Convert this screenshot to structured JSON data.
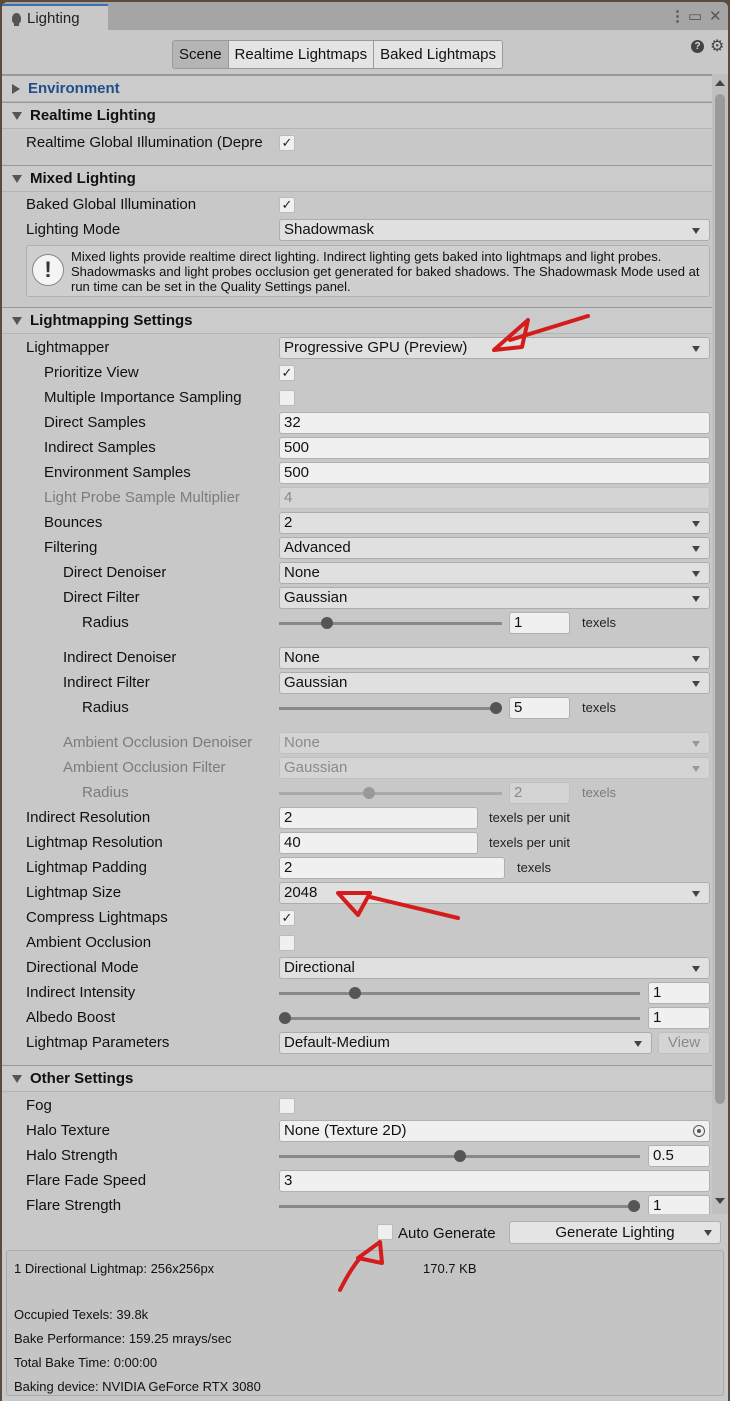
{
  "window": {
    "tab_title": "Lighting",
    "tab_icon": "bulb-icon",
    "controls": [
      "more-icon",
      "maximize-icon",
      "close-icon"
    ]
  },
  "toolbar": {
    "tabs": [
      {
        "label": "Scene",
        "active": true
      },
      {
        "label": "Realtime Lightmaps",
        "active": false
      },
      {
        "label": "Baked Lightmaps",
        "active": false
      }
    ],
    "help_icon": "?",
    "settings_icon": "gear-icon"
  },
  "sections": {
    "environment": {
      "title": "Environment",
      "expanded": false
    },
    "realtime": {
      "title": "Realtime Lighting",
      "expanded": true,
      "realtime_gi_label": "Realtime Global Illumination (Depre",
      "realtime_gi_checked": true
    },
    "mixed": {
      "title": "Mixed Lighting",
      "expanded": true,
      "baked_gi_label": "Baked Global Illumination",
      "baked_gi_checked": true,
      "lighting_mode_label": "Lighting Mode",
      "lighting_mode_value": "Shadowmask",
      "help_text": "Mixed lights provide realtime direct lighting. Indirect lighting gets baked into lightmaps and light probes. Shadowmasks and light probes occlusion get generated for baked shadows. The Shadowmask Mode used at run time can be set in the Quality Settings panel."
    },
    "lightmapping": {
      "title": "Lightmapping Settings",
      "expanded": true,
      "lightmapper": {
        "label": "Lightmapper",
        "value": "Progressive GPU (Preview)"
      },
      "prioritize_view": {
        "label": "Prioritize View",
        "checked": true
      },
      "mis": {
        "label": "Multiple Importance Sampling",
        "checked": false
      },
      "direct_samples": {
        "label": "Direct Samples",
        "value": "32"
      },
      "indirect_samples": {
        "label": "Indirect Samples",
        "value": "500"
      },
      "environment_samples": {
        "label": "Environment Samples",
        "value": "500"
      },
      "light_probe_mult": {
        "label": "Light Probe Sample Multiplier",
        "value": "4",
        "disabled": true
      },
      "bounces": {
        "label": "Bounces",
        "value": "2"
      },
      "filtering": {
        "label": "Filtering",
        "value": "Advanced"
      },
      "direct_denoiser": {
        "label": "Direct Denoiser",
        "value": "None"
      },
      "direct_filter": {
        "label": "Direct Filter",
        "value": "Gaussian"
      },
      "direct_radius": {
        "label": "Radius",
        "value": "1",
        "unit": "texels",
        "slider_fraction": 0.2
      },
      "indirect_denoiser": {
        "label": "Indirect Denoiser",
        "value": "None"
      },
      "indirect_filter": {
        "label": "Indirect Filter",
        "value": "Gaussian"
      },
      "indirect_radius": {
        "label": "Radius",
        "value": "5",
        "unit": "texels",
        "slider_fraction": 1.0
      },
      "ao_denoiser": {
        "label": "Ambient Occlusion Denoiser",
        "value": "None",
        "disabled": true
      },
      "ao_filter": {
        "label": "Ambient Occlusion Filter",
        "value": "Gaussian",
        "disabled": true
      },
      "ao_radius": {
        "label": "Radius",
        "value": "2",
        "unit": "texels",
        "slider_fraction": 0.4,
        "disabled": true
      },
      "indirect_resolution": {
        "label": "Indirect Resolution",
        "value": "2",
        "unit": "texels per unit"
      },
      "lightmap_resolution": {
        "label": "Lightmap Resolution",
        "value": "40",
        "unit": "texels per unit"
      },
      "lightmap_padding": {
        "label": "Lightmap Padding",
        "value": "2",
        "unit": "texels"
      },
      "lightmap_size": {
        "label": "Lightmap Size",
        "value": "2048"
      },
      "compress_lightmaps": {
        "label": "Compress Lightmaps",
        "checked": true
      },
      "ambient_occlusion": {
        "label": "Ambient Occlusion",
        "checked": false
      },
      "directional_mode": {
        "label": "Directional Mode",
        "value": "Directional"
      },
      "indirect_intensity": {
        "label": "Indirect Intensity",
        "value": "1",
        "slider_fraction": 0.2
      },
      "albedo_boost": {
        "label": "Albedo Boost",
        "value": "1",
        "slider_fraction": 0.0
      },
      "lightmap_parameters": {
        "label": "Lightmap Parameters",
        "value": "Default-Medium",
        "view_label": "View"
      }
    },
    "other": {
      "title": "Other Settings",
      "expanded": true,
      "fog": {
        "label": "Fog",
        "checked": false
      },
      "halo_texture": {
        "label": "Halo Texture",
        "value": "None (Texture 2D)"
      },
      "halo_strength": {
        "label": "Halo Strength",
        "value": "0.5",
        "slider_fraction": 0.5
      },
      "flare_fade_speed": {
        "label": "Flare Fade Speed",
        "value": "3"
      },
      "flare_strength": {
        "label": "Flare Strength",
        "value": "1",
        "slider_fraction": 1.0
      }
    }
  },
  "bottom": {
    "auto_generate_label": "Auto Generate",
    "auto_generate_checked": false,
    "generate_button": "Generate Lighting"
  },
  "stats": {
    "lightmap_info": "1 Directional Lightmap: 256x256px",
    "lightmap_size": "170.7 KB",
    "occupied_texels": "Occupied Texels: 39.8k",
    "bake_performance": "Bake Performance: 159.25 mrays/sec",
    "total_bake_time": "Total Bake Time: 0:00:00",
    "baking_device": "Baking device: NVIDIA GeForce RTX 3080"
  },
  "annotations": {
    "color": "#d41c1c",
    "marks": [
      "arrow-to-lightmapper",
      "arrow-to-lightmap-size",
      "arrow-to-auto-generate"
    ]
  }
}
